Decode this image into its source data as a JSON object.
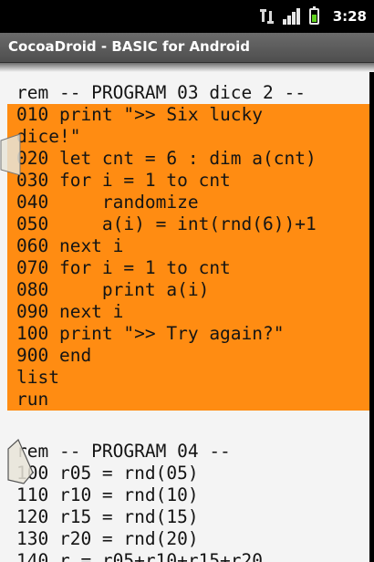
{
  "status_bar": {
    "icons": [
      "data-transfer-icon",
      "signal-strength-icon",
      "battery-charging-icon"
    ],
    "time": "3:28"
  },
  "app": {
    "title": "CocoaDroid - BASIC for Android"
  },
  "colors": {
    "selection": "#ff8c12",
    "editor_background": "#f4f4f4",
    "title_bar": "#5a5a5a"
  },
  "editor": {
    "program_03": {
      "header": "rem -- PROGRAM 03 dice 2 --",
      "selected_lines": [
        "010 print \">> Six lucky",
        "dice!\"",
        "020 let cnt = 6 : dim a(cnt)",
        "030 for i = 1 to cnt",
        "040     randomize",
        "050     a(i) = int(rnd(6))+1",
        "060 next i",
        "070 for i = 1 to cnt",
        "080     print a(i)",
        "090 next i",
        "100 print \">> Try again?\"",
        "900 end",
        "list",
        "run"
      ]
    },
    "program_04": {
      "lines": [
        "rem -- PROGRAM 04 --",
        "100 r05 = rnd(05)",
        "110 r10 = rnd(10)",
        "120 r15 = rnd(15)",
        "130 r20 = rnd(20)",
        "140 r = r05+r10+r15+r20"
      ]
    }
  }
}
